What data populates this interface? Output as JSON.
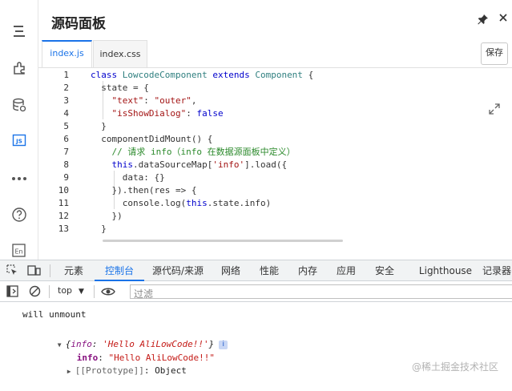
{
  "panel": {
    "title": "源码面板",
    "file_tabs": [
      {
        "label": "index.js",
        "active": true
      },
      {
        "label": "index.css",
        "active": false
      }
    ],
    "save_label": "保存"
  },
  "rail_icons": [
    "outline-icon",
    "components-icon",
    "datasource-icon",
    "js-icon",
    "more-icon",
    "help-icon",
    "i18n-icon"
  ],
  "rail_labels": {
    "js": "JS",
    "i18n": "En"
  },
  "code_lines": [
    {
      "n": "1",
      "tokens": [
        {
          "t": "class ",
          "c": "kw"
        },
        {
          "t": "LowcodeComponent ",
          "c": "cls"
        },
        {
          "t": "extends ",
          "c": "kw"
        },
        {
          "t": "Component ",
          "c": "cls"
        },
        {
          "t": "{",
          "c": ""
        }
      ]
    },
    {
      "n": "2",
      "tokens": [
        {
          "t": "  state = {",
          "c": ""
        }
      ]
    },
    {
      "n": "3",
      "tokens": [
        {
          "t": "    ",
          "c": ""
        },
        {
          "t": "\"text\"",
          "c": "str"
        },
        {
          "t": ": ",
          "c": ""
        },
        {
          "t": "\"outer\"",
          "c": "str"
        },
        {
          "t": ",",
          "c": ""
        }
      ]
    },
    {
      "n": "4",
      "tokens": [
        {
          "t": "    ",
          "c": ""
        },
        {
          "t": "\"isShowDialog\"",
          "c": "str"
        },
        {
          "t": ": ",
          "c": ""
        },
        {
          "t": "false",
          "c": "kw"
        }
      ]
    },
    {
      "n": "5",
      "tokens": [
        {
          "t": "  }",
          "c": ""
        }
      ]
    },
    {
      "n": "6",
      "tokens": [
        {
          "t": "  componentDidMount() {",
          "c": ""
        }
      ]
    },
    {
      "n": "7",
      "tokens": [
        {
          "t": "    ",
          "c": ""
        },
        {
          "t": "// 请求 info（info 在数据源面板中定义）",
          "c": "cmt"
        }
      ]
    },
    {
      "n": "8",
      "tokens": [
        {
          "t": "    ",
          "c": ""
        },
        {
          "t": "this",
          "c": "kw"
        },
        {
          "t": ".dataSourceMap[",
          "c": ""
        },
        {
          "t": "'info'",
          "c": "str"
        },
        {
          "t": "].load({",
          "c": ""
        }
      ]
    },
    {
      "n": "9",
      "tokens": [
        {
          "t": "      data: {}",
          "c": ""
        }
      ]
    },
    {
      "n": "10",
      "tokens": [
        {
          "t": "    }).then(res => {",
          "c": ""
        }
      ]
    },
    {
      "n": "11",
      "tokens": [
        {
          "t": "      console.log(",
          "c": ""
        },
        {
          "t": "this",
          "c": "kw"
        },
        {
          "t": ".state.info)",
          "c": ""
        }
      ]
    },
    {
      "n": "12",
      "tokens": [
        {
          "t": "    })",
          "c": ""
        }
      ]
    },
    {
      "n": "13",
      "tokens": [
        {
          "t": "  }",
          "c": ""
        }
      ]
    }
  ],
  "devtools": {
    "tabs": [
      {
        "label": "元素",
        "active": false
      },
      {
        "label": "控制台",
        "active": true
      },
      {
        "label": "源代码/来源",
        "active": false
      },
      {
        "label": "网络",
        "active": false
      },
      {
        "label": "性能",
        "active": false
      },
      {
        "label": "内存",
        "active": false
      },
      {
        "label": "应用",
        "active": false
      },
      {
        "label": "安全",
        "active": false
      },
      {
        "label": "Lighthouse",
        "active": false
      },
      {
        "label": "记录器",
        "active": false
      }
    ],
    "context": "top",
    "filter_placeholder": "过滤"
  },
  "console": {
    "log_line": "will unmount",
    "obj_prefix": "{",
    "obj_key": "info",
    "obj_sep": ": ",
    "obj_value": "'Hello AliLowCode!!'",
    "obj_suffix": "}",
    "info_badge": "i",
    "prop_key": "info",
    "prop_sep": ": ",
    "prop_value": "\"Hello AliLowCode!!\"",
    "proto_label": "[[Prototype]]",
    "proto_sep": ": ",
    "proto_value": "Object"
  },
  "watermark": "@稀土掘金技术社区"
}
